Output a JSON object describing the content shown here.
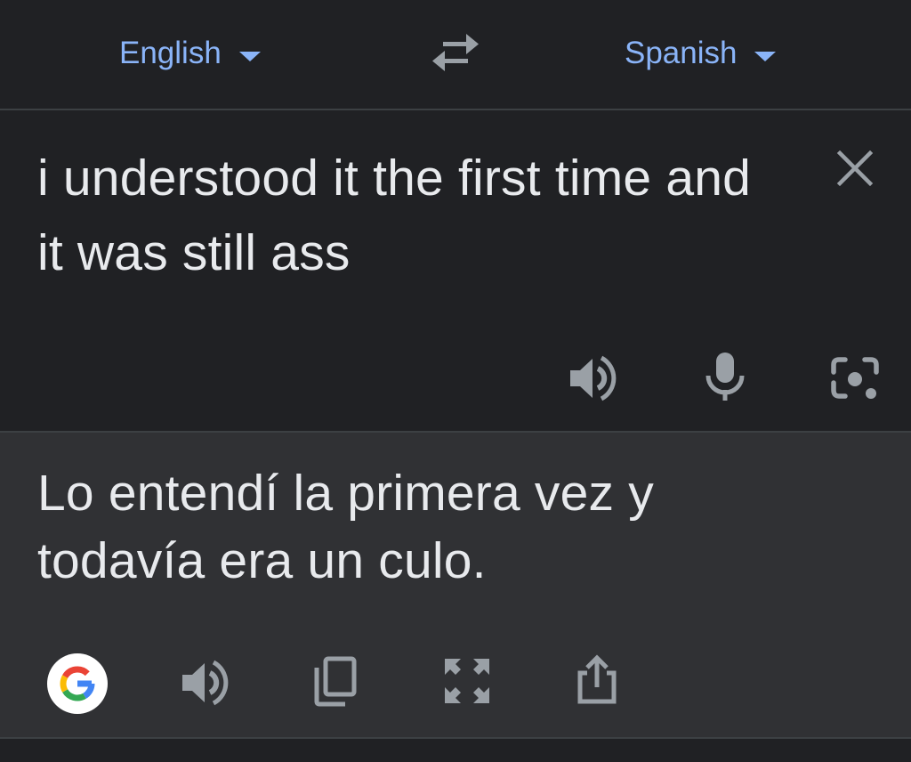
{
  "language_bar": {
    "source_language": "English",
    "target_language": "Spanish"
  },
  "source": {
    "text": "i understood it the first time and it was still ass"
  },
  "translation": {
    "text": "Lo entendí la primera vez y todavía era un culo."
  },
  "icons": {
    "swap": "swap-arrows-icon",
    "clear": "close-icon",
    "listen": "speaker-icon",
    "mic": "microphone-icon",
    "camera": "camera-lens-icon",
    "google": "google-logo",
    "copy": "copy-icon",
    "fullscreen": "fullscreen-icon",
    "share": "share-icon"
  },
  "colors": {
    "background": "#202124",
    "translation_background": "#303134",
    "accent": "#8ab4f8",
    "text": "#e8eaed",
    "icon": "#9aa0a6"
  }
}
